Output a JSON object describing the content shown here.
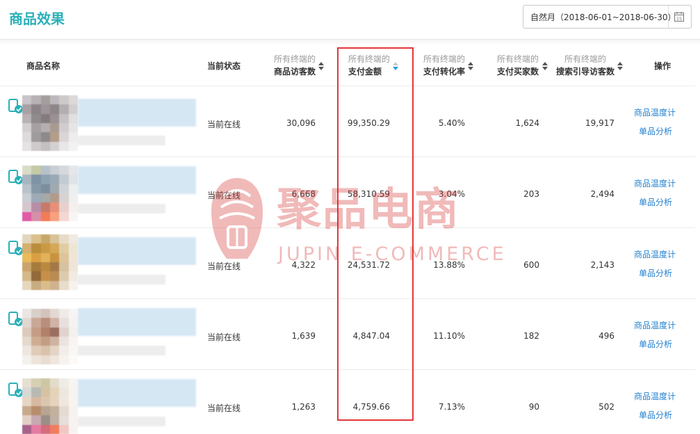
{
  "page": {
    "title": "商品效果",
    "date_range": "自然月（2018-06-01~2018-06-30）",
    "calendar_day": "15"
  },
  "table": {
    "columns": {
      "name": "商品名称",
      "status": "当前状态",
      "visitors": {
        "sub": "所有终端的",
        "main": "商品访客数"
      },
      "payment": {
        "sub": "所有终端的",
        "main": "支付金额"
      },
      "conversion": {
        "sub": "所有终端的",
        "main": "支付转化率"
      },
      "buyers": {
        "sub": "所有终端的",
        "main": "支付买家数"
      },
      "search": {
        "sub": "所有终端的",
        "main": "搜索引导访客数"
      },
      "action": "操作"
    },
    "rows": [
      {
        "status": "当前在线",
        "visitors": "30,096",
        "payment": "99,350.29",
        "conversion": "5.40%",
        "buyers": "1,624",
        "search": "19,917",
        "action1": "商品温度计",
        "action2": "单品分析"
      },
      {
        "status": "当前在线",
        "visitors": "6,668",
        "payment": "58,310.59",
        "conversion": "3.04%",
        "buyers": "203",
        "search": "2,494",
        "action1": "商品温度计",
        "action2": "单品分析"
      },
      {
        "status": "当前在线",
        "visitors": "4,322",
        "payment": "24,531.72",
        "conversion": "13.88%",
        "buyers": "600",
        "search": "2,143",
        "action1": "商品温度计",
        "action2": "单品分析"
      },
      {
        "status": "当前在线",
        "visitors": "1,639",
        "payment": "4,847.04",
        "conversion": "11.10%",
        "buyers": "182",
        "search": "496",
        "action1": "商品温度计",
        "action2": "单品分析"
      },
      {
        "status": "当前在线",
        "visitors": "1,263",
        "payment": "4,759.66",
        "conversion": "7.13%",
        "buyers": "90",
        "search": "502",
        "action1": "商品温度计",
        "action2": "单品分析"
      }
    ]
  },
  "watermark": {
    "cn": "聚品电商",
    "en": "JUPIN E-COMMERCE"
  },
  "colors": {
    "accent": "#2ab0b9",
    "link": "#1f7fcf",
    "highlight": "#e4363a",
    "sort_active": "#2b9ee0"
  }
}
